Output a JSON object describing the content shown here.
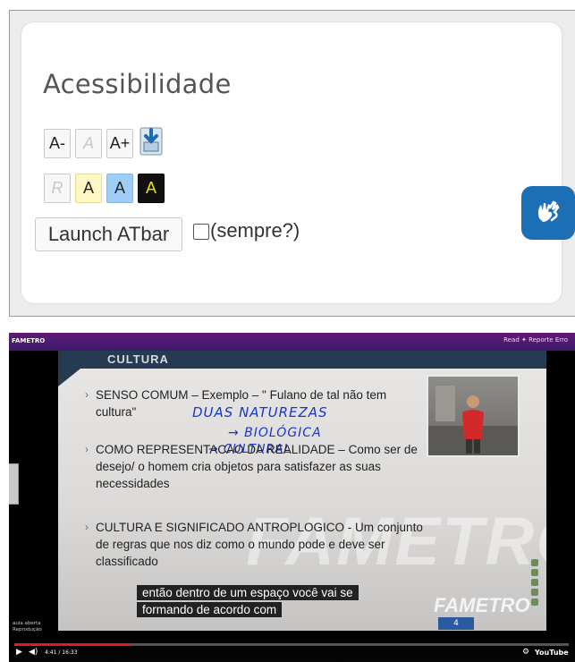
{
  "accessibility": {
    "title": "Acessibilidade",
    "font_buttons": [
      "A-",
      "A",
      "A+"
    ],
    "contrast_buttons": [
      "R",
      "A",
      "A",
      "A"
    ],
    "launch_label": "Launch ATbar",
    "always_label": "(sempre?)",
    "sign_button_color": "#1c6fb5"
  },
  "video": {
    "topbar_logo": "FAMETRO",
    "topbar_links": "Read   ✦   Reporte Erro",
    "slide_title": "CULTURA",
    "bullets": [
      "SENSO COMUM – Exemplo – \" Fulano de tal não tem cultura\"",
      "COMO REPRESENTACAO DA REALIDADE – Como ser de desejo/ o homem cria objetos para satisfazer as suas necessidades",
      "CULTURA E SIGNIFICADO ANTROPLOGICO - Um conjunto de regras que nos diz como o mundo pode e deve ser classificado"
    ],
    "handwriting": [
      "DUAS NATUREZAS",
      "→ BIOLÓGICA",
      "→ CULTURAL"
    ],
    "watermark": "FAMETRO",
    "caption_lines": [
      "então dentro de um espaço você vai se",
      "formando de acordo com"
    ],
    "brand": "FAMETRO",
    "page_number": "4",
    "uploader_lines": [
      "aula aberta",
      "Reprodução"
    ],
    "time": "4:41 / 16:33",
    "youtube_label": "YouTube",
    "progress_fraction": 0.21
  }
}
